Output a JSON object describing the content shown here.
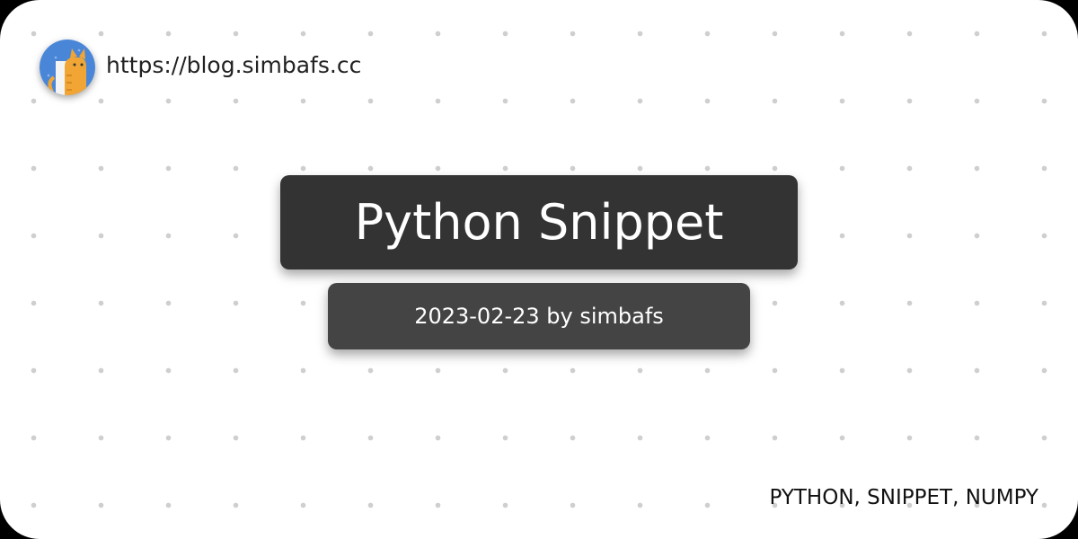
{
  "header": {
    "avatar_icon": "cat-avatar-icon",
    "site_url": "https://blog.simbafs.cc"
  },
  "post": {
    "title": "Python Snippet",
    "meta": "2023-02-23 by simbafs"
  },
  "footer": {
    "tags": "PYTHON, SNIPPET, NUMPY"
  },
  "colors": {
    "page_background": "#ffffff",
    "dot_pattern": "#cfcfcf",
    "title_box": "#333333",
    "meta_box": "#444444",
    "avatar_background": "#4a86d8",
    "cat": "#f0a534"
  }
}
